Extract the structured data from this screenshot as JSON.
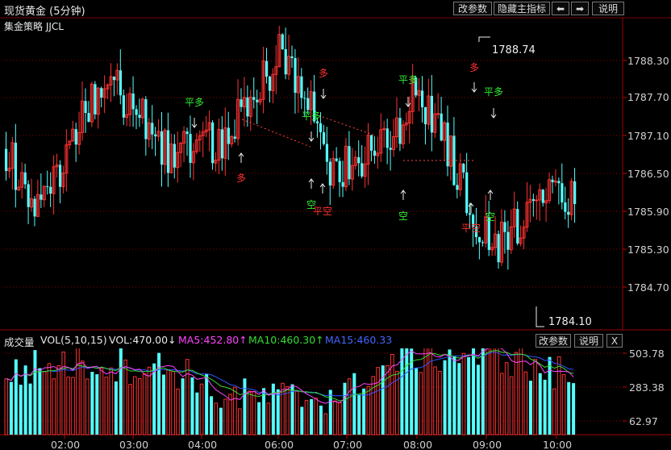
{
  "window": {
    "title": "现货黄金 (5分钟)",
    "strategy": "集金策略 JJCL"
  },
  "toolbar": {
    "edit_params": "改参数",
    "hide_indicator": "隐藏主指标",
    "prev": "⬅",
    "next": "➡",
    "help": "说明"
  },
  "main_chart": {
    "price_ticks": [
      "1788.30",
      "1787.70",
      "1787.10",
      "1786.50",
      "1785.90",
      "1785.30",
      "1784.70"
    ],
    "high_label": "1788.74",
    "low_label": "1784.10",
    "signals": [
      {
        "text": "平多",
        "dir": "down",
        "color": "green"
      },
      {
        "text": "多",
        "dir": "up",
        "color": "red"
      },
      {
        "text": "多",
        "dir": "down",
        "color": "red"
      },
      {
        "text": "平多",
        "dir": "down",
        "color": "green"
      },
      {
        "text": "空",
        "dir": "up",
        "color": "green"
      },
      {
        "text": "平空",
        "dir": "up",
        "color": "red"
      },
      {
        "text": "平多",
        "dir": "down",
        "color": "green"
      },
      {
        "text": "空",
        "dir": "up",
        "color": "green"
      },
      {
        "text": "多",
        "dir": "down",
        "color": "red"
      },
      {
        "text": "平多",
        "dir": "down",
        "color": "green"
      },
      {
        "text": "平空",
        "dir": "up",
        "color": "red"
      },
      {
        "text": "空",
        "dir": "up",
        "color": "green"
      }
    ]
  },
  "volume_panel": {
    "title": "成交量",
    "indicator": "VOL(5,10,15)",
    "vol": "VOL:470.00↓",
    "ma5": "MA5:452.80↑",
    "ma10": "MA10:460.30↑",
    "ma15": "MA15:460.33",
    "edit_params": "改参数",
    "help": "说明",
    "close": "X",
    "ticks": [
      "503.78",
      "283.38",
      "62.97"
    ]
  },
  "time_axis": [
    "02:00",
    "03:00",
    "04:00",
    "06:00",
    "07:00",
    "08:00",
    "09:00",
    "10:00"
  ],
  "colors": {
    "up": "#ff3232",
    "down": "#54ffff",
    "ma5": "#ff44ff",
    "ma10": "#33dd33",
    "ma15": "#3355ff",
    "grid": "#8b0000",
    "signal_green": "#33ee33",
    "signal_red": "#ff3030"
  }
}
